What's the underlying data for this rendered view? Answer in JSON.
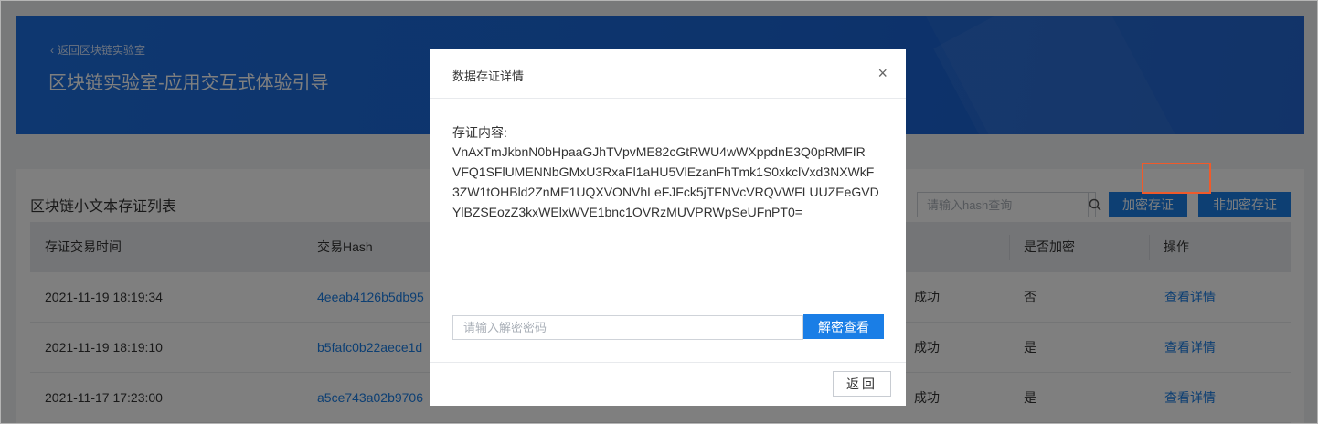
{
  "header": {
    "back_label": "返回区块链实验室",
    "title": "区块链实验室-应用交互式体验引导"
  },
  "list": {
    "title": "区块链小文本存证列表",
    "search_placeholder": "请输入hash查询",
    "encrypt_button": "加密存证",
    "plain_button": "非加密存证",
    "columns": [
      "存证交易时间",
      "交易Hash",
      "是否加密",
      "操作"
    ],
    "rows": [
      {
        "time": "2021-11-19 18:19:34",
        "hash": "4eeab4126b5db95",
        "status": "成功",
        "encrypted": "否",
        "action": "查看详情"
      },
      {
        "time": "2021-11-19 18:19:10",
        "hash": "b5fafc0b22aece1d",
        "status": "成功",
        "encrypted": "是",
        "action": "查看详情"
      },
      {
        "time": "2021-11-17 17:23:00",
        "hash": "a5ce743a02b9706",
        "status": "成功",
        "encrypted": "是",
        "action": "查看详情"
      }
    ]
  },
  "modal": {
    "title": "数据存证详情",
    "close_icon": "×",
    "content_label": "存证内容:",
    "content_lines": [
      "VnAxTmJkbnN0bHpaaGJhTVpvME82cGtRWU4wWXppdnE3Q0pRMFIR",
      "VFQ1SFlUMENNbGMxU3RxaFl1aHU5VlEzanFhTmk1S0xkclVxd3NXWkF",
      "3ZW1tOHBld2ZnME1UQXVONVhLeFJFck5jTFNVcVRQVWFLUUZEeGVD",
      "YlBZSEozZ3kxWElxWVE1bnc1OVRzMUVPRWpSeUFnPT0="
    ],
    "password_placeholder": "请输入解密密码",
    "decrypt_button": "解密查看",
    "return_button": "返回"
  },
  "colors": {
    "accent": "#1a7ee6",
    "banner": "#1b68d9",
    "highlight": "#f05a2a"
  }
}
